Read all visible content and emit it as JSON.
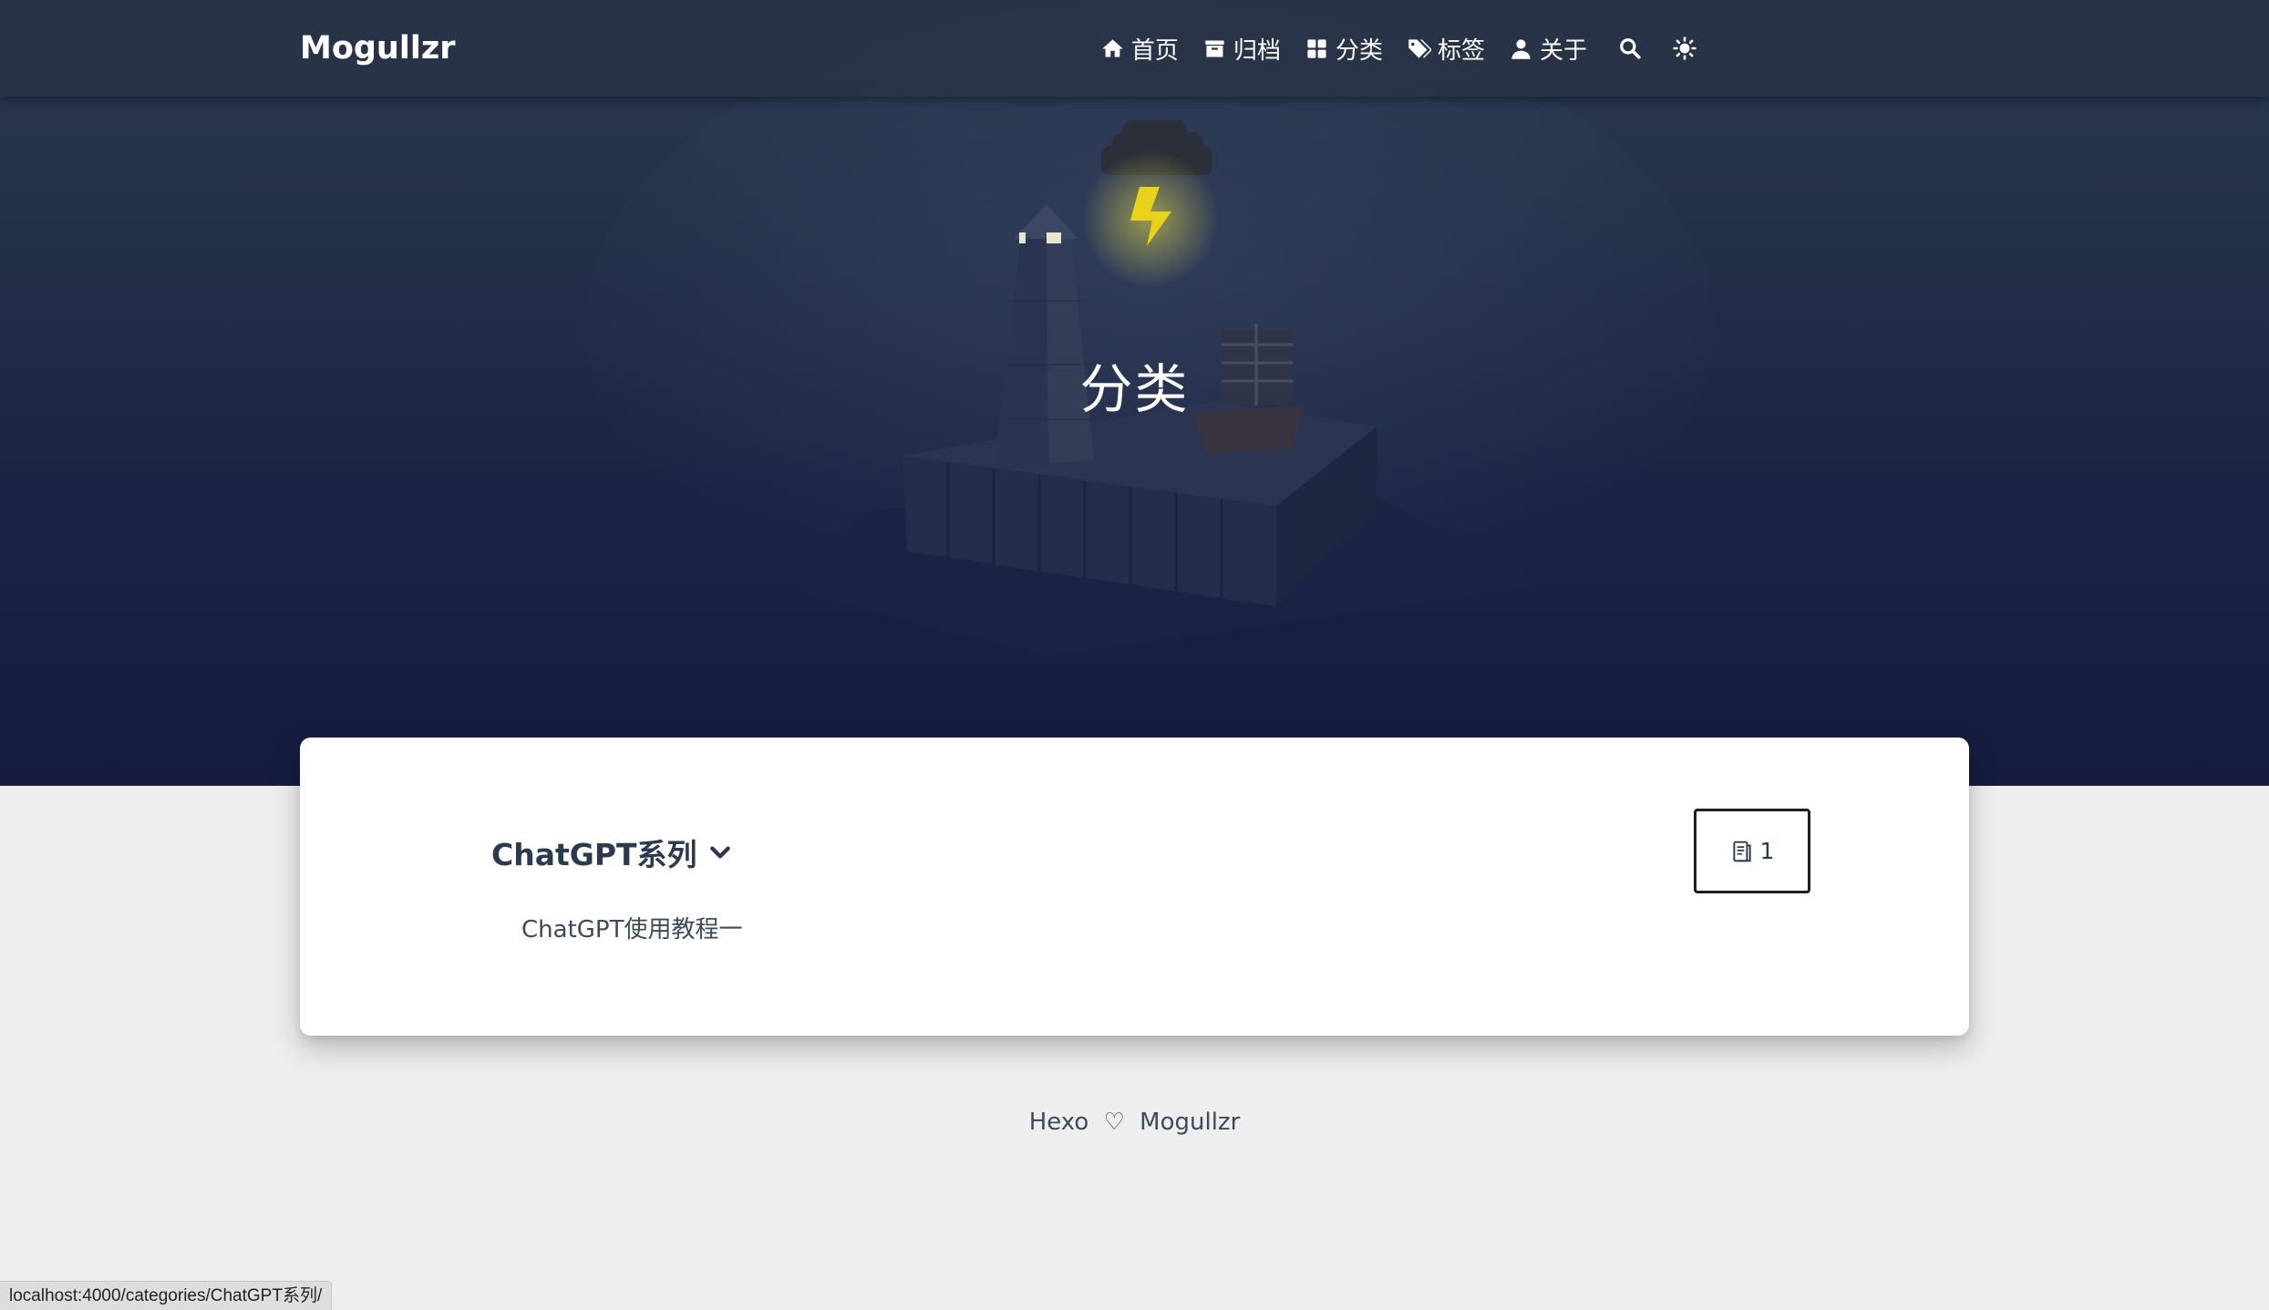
{
  "site": {
    "brand": "Mogullzr"
  },
  "nav": {
    "items": [
      {
        "label": "首页",
        "icon": "home-icon"
      },
      {
        "label": "归档",
        "icon": "archive-icon"
      },
      {
        "label": "分类",
        "icon": "grid-icon"
      },
      {
        "label": "标签",
        "icon": "tags-icon"
      },
      {
        "label": "关于",
        "icon": "user-icon"
      }
    ],
    "search_icon": "search-icon",
    "theme_icon": "sun-icon"
  },
  "banner": {
    "title": "分类"
  },
  "category": {
    "name": "ChatGPT系列",
    "expand_icon": "chevron-down-icon",
    "count_icon": "document-icon",
    "count": "1",
    "posts": [
      "ChatGPT使用教程一"
    ]
  },
  "footer": {
    "left": "Hexo",
    "heart_icon": "heart-icon",
    "right": "Mogullzr"
  },
  "statusbar": {
    "url": "localhost:4000/categories/ChatGPT系列/"
  },
  "colors": {
    "nav_bg": "#293448",
    "banner_bottom": "#151c3f",
    "page_bg": "#eeeeee",
    "text_dark": "#2c3a4f",
    "lightning": "#e8d21a"
  }
}
